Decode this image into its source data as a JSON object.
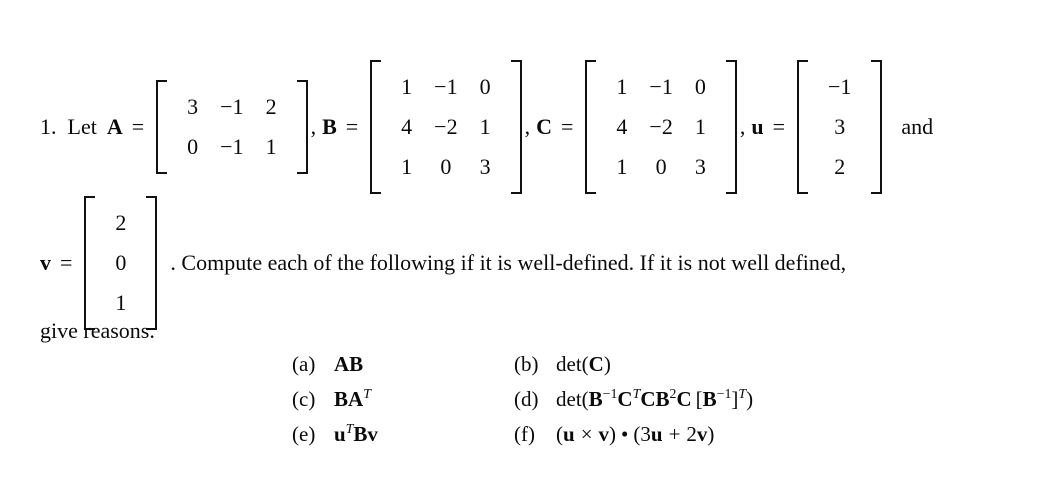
{
  "problem": {
    "number": "1.",
    "lead_in": "Let",
    "conjunction": "and",
    "sentence": ". Compute each of the following if it is well-defined.  If it is not well defined,",
    "sentence_cont": "give reasons."
  },
  "symbols": {
    "A": "A",
    "B": "B",
    "C": "C",
    "u": "u",
    "v": "v",
    "equals": "=",
    "comma": ","
  },
  "matrices": {
    "A": {
      "name": "A",
      "rows": 2,
      "cols": 3,
      "values": [
        [
          "3",
          "−1",
          "2"
        ],
        [
          "0",
          "−1",
          "1"
        ]
      ]
    },
    "B": {
      "name": "B",
      "rows": 3,
      "cols": 3,
      "values": [
        [
          "1",
          "−1",
          "0"
        ],
        [
          "4",
          "−2",
          "1"
        ],
        [
          "1",
          "0",
          "3"
        ]
      ]
    },
    "C": {
      "name": "C",
      "rows": 3,
      "cols": 3,
      "values": [
        [
          "1",
          "−1",
          "0"
        ],
        [
          "4",
          "−2",
          "1"
        ],
        [
          "1",
          "0",
          "3"
        ]
      ]
    },
    "u": {
      "name": "u",
      "rows": 3,
      "cols": 1,
      "values": [
        [
          "−1"
        ],
        [
          "3"
        ],
        [
          "2"
        ]
      ]
    },
    "v": {
      "name": "v",
      "rows": 3,
      "cols": 1,
      "values": [
        [
          "2"
        ],
        [
          "0"
        ],
        [
          "1"
        ]
      ]
    }
  },
  "items": [
    {
      "label": "(a)",
      "expr_plain": "AB"
    },
    {
      "label": "(b)",
      "expr_plain": "det(C)"
    },
    {
      "label": "(c)",
      "expr_plain": "BA^T"
    },
    {
      "label": "(d)",
      "expr_plain": "det(B^-1 C^T C B^2 C [B^-1]^T)"
    },
    {
      "label": "(e)",
      "expr_plain": "u^T B v"
    },
    {
      "label": "(f)",
      "expr_plain": "(u × v) • (3u + 2v)"
    }
  ],
  "item_parts": {
    "det": "det",
    "open_paren": "(",
    "close_paren": ")",
    "open_brack": "[",
    "close_brack": "]",
    "minus_one": "−1",
    "two": "2",
    "three": "3",
    "T": "T",
    "cross": "×",
    "dot": "•",
    "plus": "+"
  },
  "colors": {
    "page_background": "#ffffff",
    "ink": "#0a0a0a"
  }
}
